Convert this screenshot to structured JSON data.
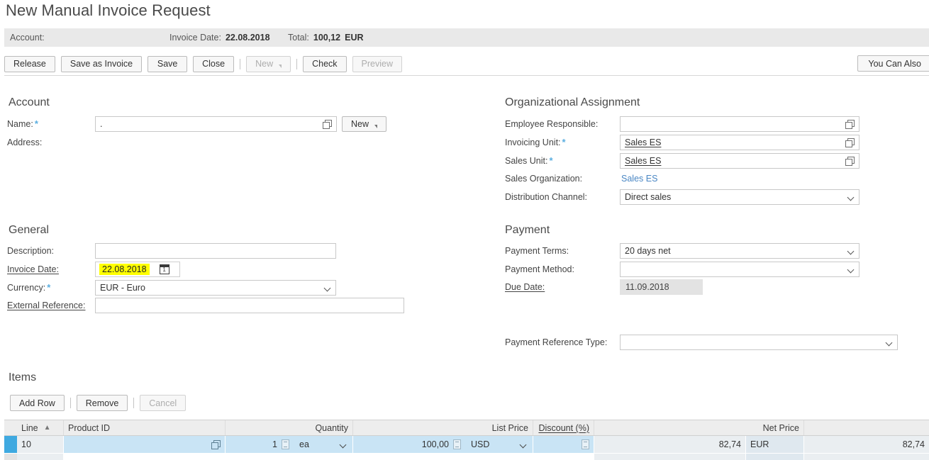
{
  "page": {
    "title": "New Manual Invoice Request"
  },
  "summary": {
    "account_label": "Account:",
    "account_value": "",
    "invoice_date_label": "Invoice Date:",
    "invoice_date_value": "22.08.2018",
    "total_label": "Total:",
    "total_value": "100,12",
    "total_currency": "EUR"
  },
  "toolbar": {
    "release": "Release",
    "save_as_invoice": "Save as Invoice",
    "save": "Save",
    "close": "Close",
    "new": "New",
    "check": "Check",
    "preview": "Preview",
    "you_can_also": "You Can Also"
  },
  "account": {
    "heading": "Account",
    "name_label": "Name:",
    "name_value": ".",
    "new_button": "New",
    "address_label": "Address:",
    "address_value": ""
  },
  "organizational": {
    "heading": "Organizational Assignment",
    "employee_responsible_label": "Employee Responsible:",
    "employee_responsible_value": "",
    "invoicing_unit_label": "Invoicing Unit:",
    "invoicing_unit_value": "Sales ES",
    "sales_unit_label": "Sales Unit:",
    "sales_unit_value": "Sales ES",
    "sales_organization_label": "Sales Organization:",
    "sales_organization_value": "Sales ES",
    "distribution_channel_label": "Distribution Channel:",
    "distribution_channel_value": "Direct sales"
  },
  "general": {
    "heading": "General",
    "description_label": "Description:",
    "description_value": "",
    "invoice_date_label": "Invoice Date:",
    "invoice_date_value": "22.08.2018",
    "currency_label": "Currency:",
    "currency_value": "EUR - Euro",
    "external_reference_label": "External Reference:",
    "external_reference_value": ""
  },
  "payment": {
    "heading": "Payment",
    "payment_terms_label": "Payment Terms:",
    "payment_terms_value": "20 days net",
    "payment_method_label": "Payment Method:",
    "payment_method_value": "",
    "due_date_label": "Due Date:",
    "due_date_value": "11.09.2018",
    "payment_reference_type_label": "Payment Reference Type:",
    "payment_reference_type_value": ""
  },
  "items": {
    "heading": "Items",
    "add_row": "Add Row",
    "remove": "Remove",
    "cancel": "Cancel",
    "columns": {
      "line": "Line",
      "product_id": "Product ID",
      "quantity": "Quantity",
      "list_price": "List Price",
      "discount": "Discount (%)",
      "net_price": "Net Price"
    },
    "rows": [
      {
        "line": "10",
        "product_id": "",
        "quantity": "1",
        "uom": "ea",
        "list_price": "100,00",
        "list_price_currency": "USD",
        "discount": "",
        "net_price": "82,74",
        "net_price_currency": "EUR",
        "net_value": "82,74"
      }
    ]
  },
  "colors": {
    "accent": "#3fa9e0",
    "row_selected": "#c9e4f5",
    "required_star": "#5aaee0",
    "link": "#4a87c4",
    "highlight": "#ffff00"
  }
}
